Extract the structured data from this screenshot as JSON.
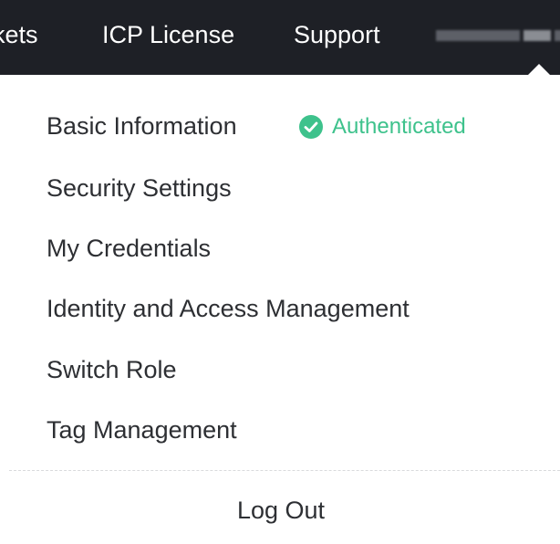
{
  "topbar": {
    "nav_items": [
      {
        "label": "kets"
      },
      {
        "label": "ICP License"
      },
      {
        "label": "Support"
      }
    ]
  },
  "menu": {
    "items": [
      {
        "label": "Basic Information"
      },
      {
        "label": "Security Settings"
      },
      {
        "label": "My Credentials"
      },
      {
        "label": "Identity and Access Management"
      },
      {
        "label": "Switch Role"
      },
      {
        "label": "Tag Management"
      }
    ],
    "auth_status": "Authenticated",
    "logout_label": "Log Out"
  },
  "colors": {
    "topbar_bg": "#1e2026",
    "auth_green": "#3ec28c",
    "menu_text": "#2d2f33"
  },
  "icons": {
    "auth": "check-circle-icon"
  }
}
